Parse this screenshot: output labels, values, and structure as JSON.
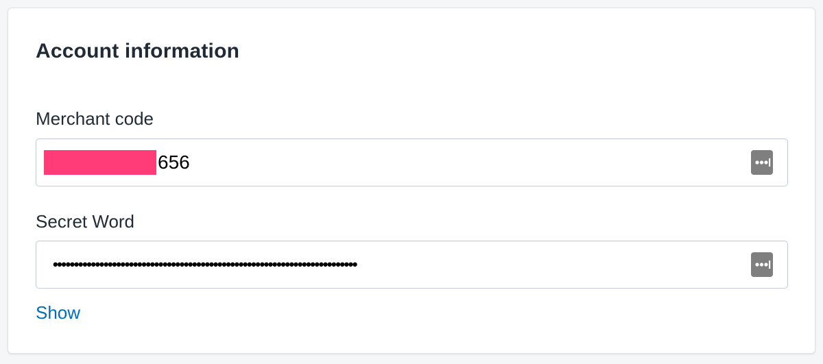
{
  "card": {
    "title": "Account information"
  },
  "merchant_code": {
    "label": "Merchant code",
    "value_visible_suffix": "656",
    "redaction_color": "#ff3c78",
    "icon": "password-manager-icon"
  },
  "secret_word": {
    "label": "Secret Word",
    "masked_value": "••••••••••••••••••••••••••••••••••••••••••••••••••••••••••••••••••••••••",
    "icon": "password-manager-icon"
  },
  "show_link": {
    "label": "Show",
    "color": "#006fbb"
  },
  "colors": {
    "page_background": "#f4f6f8",
    "card_background": "#ffffff",
    "text": "#212b36",
    "field_border": "#c4cdd5",
    "icon_background": "#7f7f7f"
  }
}
